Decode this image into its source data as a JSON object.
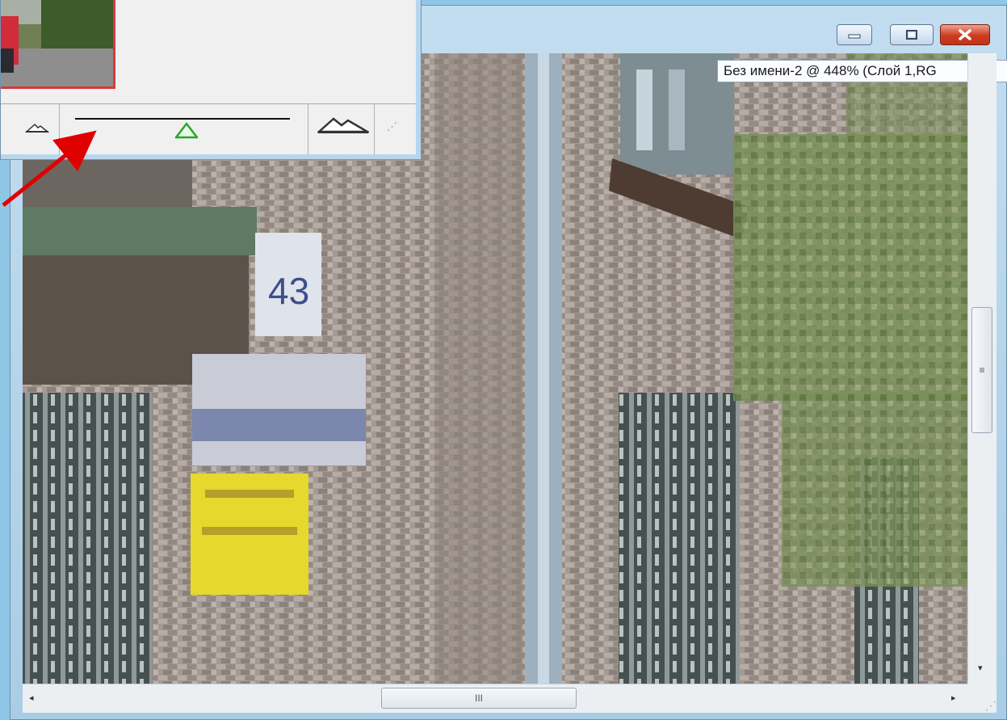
{
  "window": {
    "title": "Без имени-2 @ 448% (Слой 1,RG",
    "minimize_label": "Свернуть",
    "maximize_label": "Развернуть",
    "close_label": "Закрыть"
  },
  "scrollbars": {
    "vertical_thumb_grip": "≡",
    "horizontal_thumb_grip": "III",
    "left_arrow": "◂",
    "right_arrow": "▸",
    "down_arrow": "▾"
  },
  "navigator": {
    "zoom_level_fraction": 0.52
  },
  "canvas_content": {
    "house_number": "43"
  },
  "colors": {
    "close_button": "#c2341a",
    "annotation_arrow": "#e00000",
    "thumbnail_frame": "#d63a3a",
    "zoom_handle": "#2aa52a"
  }
}
